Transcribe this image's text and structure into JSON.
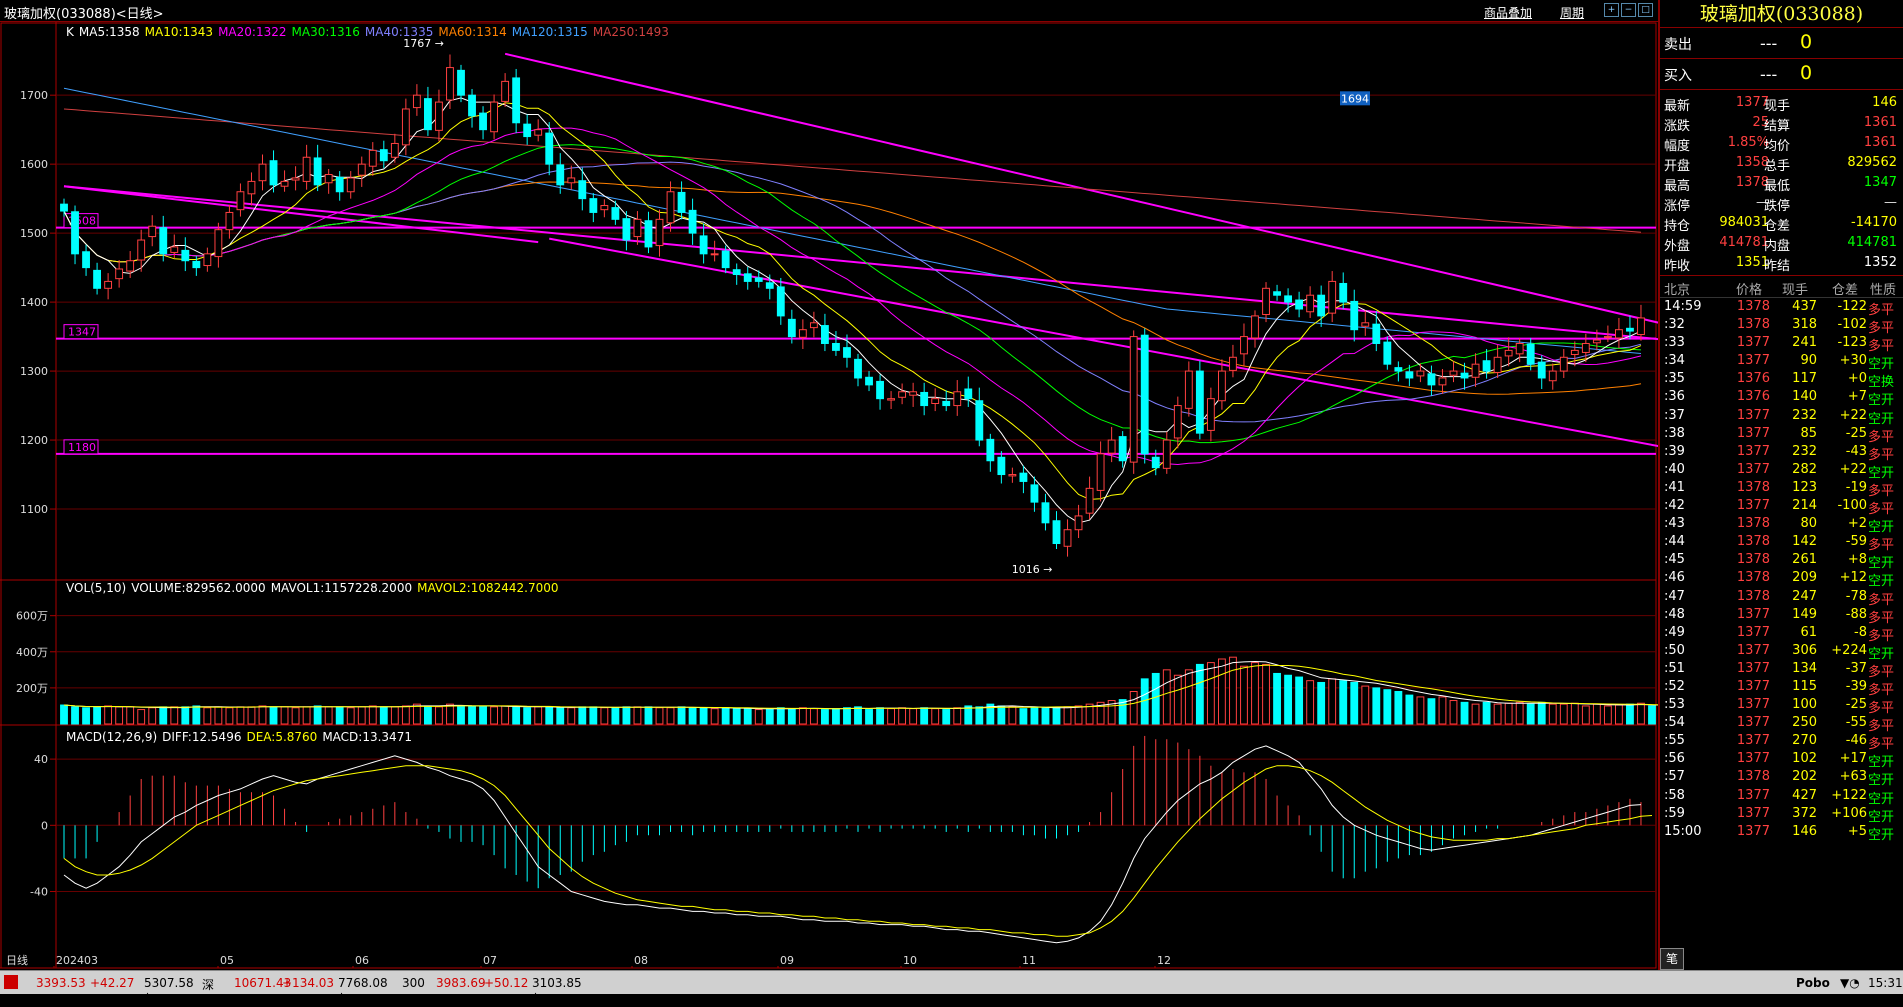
{
  "window": {
    "title": "玻璃加权(033088)<日线>",
    "link_overlay": "商品叠加",
    "link_period": "周期"
  },
  "indicators": {
    "main": [
      {
        "t": "K",
        "c": "#ffffff"
      },
      {
        "t": "MA5:1358",
        "c": "#ffffff"
      },
      {
        "t": "MA10:1343",
        "c": "#ffff00"
      },
      {
        "t": "MA20:1322",
        "c": "#ff00ff"
      },
      {
        "t": "MA30:1316",
        "c": "#00ff00"
      },
      {
        "t": "MA40:1335",
        "c": "#8080ff"
      },
      {
        "t": "MA60:1314",
        "c": "#ff8000"
      },
      {
        "t": "MA120:1315",
        "c": "#40a0ff"
      },
      {
        "t": "MA250:1493",
        "c": "#d04040"
      }
    ],
    "vol": [
      {
        "t": "VOL(5,10)",
        "c": "#ffffff"
      },
      {
        "t": "VOLUME:829562.0000",
        "c": "#ffffff"
      },
      {
        "t": "MAVOL1:1157228.2000",
        "c": "#ffffff"
      },
      {
        "t": "MAVOL2:1082442.7000",
        "c": "#ffff00"
      }
    ],
    "macd": [
      {
        "t": "MACD(12,26,9)",
        "c": "#ffffff"
      },
      {
        "t": "DIFF:12.5496",
        "c": "#ffffff"
      },
      {
        "t": "DEA:5.8760",
        "c": "#ffff00"
      },
      {
        "t": "MACD:13.3471",
        "c": "#ffffff"
      }
    ]
  },
  "axes": {
    "price_ticks": [
      "1700",
      "1600",
      "1500",
      "1400",
      "1300",
      "1200",
      "1100"
    ],
    "vol_ticks": [
      "600万",
      "400万",
      "200万"
    ],
    "macd_ticks": [
      "40",
      "0",
      "-40"
    ],
    "x_labels": [
      "日线",
      "202403",
      "05",
      "06",
      "07",
      "08",
      "09",
      "10",
      "11",
      "12"
    ]
  },
  "annotations": {
    "high": "1767",
    "low": "1016",
    "level1": "1508",
    "level2": "1347",
    "level3": "1180",
    "cursor_price": "1694"
  },
  "chart_data": {
    "type": "candlestick",
    "ylim": [
      1000,
      1780
    ],
    "macd_ylim": [
      -85,
      60
    ],
    "levels": [
      1508,
      1347,
      1180
    ],
    "high_label": 1767,
    "low_label": 1016,
    "closes": [
      1532,
      1470,
      1450,
      1420,
      1430,
      1448,
      1460,
      1490,
      1510,
      1470,
      1480,
      1460,
      1450,
      1470,
      1505,
      1530,
      1560,
      1575,
      1600,
      1570,
      1575,
      1580,
      1610,
      1570,
      1585,
      1560,
      1580,
      1600,
      1620,
      1605,
      1630,
      1680,
      1700,
      1650,
      1690,
      1740,
      1700,
      1670,
      1650,
      1690,
      1720,
      1660,
      1640,
      1650,
      1600,
      1570,
      1580,
      1550,
      1530,
      1540,
      1520,
      1490,
      1520,
      1480,
      1520,
      1560,
      1530,
      1500,
      1470,
      1470,
      1450,
      1440,
      1430,
      1430,
      1420,
      1380,
      1350,
      1360,
      1370,
      1340,
      1330,
      1320,
      1290,
      1280,
      1260,
      1260,
      1270,
      1270,
      1250,
      1260,
      1250,
      1270,
      1260,
      1200,
      1170,
      1150,
      1150,
      1140,
      1110,
      1080,
      1050,
      1070,
      1090,
      1130,
      1180,
      1200,
      1170,
      1350,
      1180,
      1160,
      1200,
      1250,
      1300,
      1210,
      1260,
      1300,
      1320,
      1350,
      1380,
      1420,
      1410,
      1400,
      1390,
      1410,
      1380,
      1430,
      1400,
      1360,
      1370,
      1340,
      1310,
      1300,
      1290,
      1300,
      1280,
      1290,
      1300,
      1290,
      1310,
      1300,
      1320,
      1330,
      1340,
      1310,
      1290,
      1300,
      1320,
      1330,
      1340,
      1345,
      1350,
      1360,
      1358,
      1377
    ],
    "volumes": [
      105,
      95,
      90,
      95,
      100,
      95,
      95,
      80,
      90,
      95,
      95,
      95,
      100,
      90,
      95,
      90,
      95,
      95,
      100,
      95,
      95,
      90,
      95,
      100,
      95,
      95,
      90,
      95,
      100,
      95,
      95,
      100,
      110,
      100,
      95,
      110,
      100,
      100,
      95,
      95,
      100,
      95,
      90,
      95,
      95,
      90,
      90,
      95,
      95,
      90,
      90,
      95,
      95,
      95,
      90,
      90,
      95,
      90,
      90,
      85,
      90,
      85,
      85,
      80,
      85,
      90,
      85,
      90,
      85,
      80,
      85,
      90,
      95,
      80,
      90,
      85,
      90,
      85,
      90,
      85,
      80,
      90,
      100,
      95,
      110,
      100,
      95,
      85,
      90,
      90,
      90,
      95,
      100,
      110,
      120,
      130,
      135,
      180,
      250,
      280,
      300,
      270,
      300,
      330,
      340,
      360,
      370,
      320,
      340,
      330,
      280,
      270,
      260,
      240,
      230,
      250,
      240,
      230,
      210,
      200,
      190,
      180,
      160,
      150,
      140,
      150,
      130,
      120,
      110,
      120,
      110,
      115,
      120,
      110,
      120,
      110,
      110,
      115,
      100,
      110,
      100,
      105,
      110,
      115,
      100,
      95
    ],
    "dif": [
      -30,
      -35,
      -38,
      -35,
      -30,
      -25,
      -18,
      -10,
      -5,
      0,
      5,
      8,
      12,
      15,
      18,
      20,
      22,
      25,
      28,
      30,
      28,
      26,
      25,
      28,
      30,
      32,
      34,
      36,
      38,
      40,
      42,
      40,
      38,
      35,
      33,
      30,
      28,
      26,
      22,
      15,
      5,
      -5,
      -15,
      -25,
      -30,
      -35,
      -40,
      -42,
      -44,
      -46,
      -47,
      -48,
      -48,
      -49,
      -50,
      -50,
      -51,
      -52,
      -52,
      -53,
      -53,
      -54,
      -54,
      -55,
      -55,
      -55,
      -56,
      -57,
      -57,
      -58,
      -58,
      -58,
      -59,
      -59,
      -60,
      -60,
      -60,
      -61,
      -61,
      -62,
      -63,
      -63,
      -64,
      -64,
      -65,
      -66,
      -67,
      -68,
      -69,
      -70,
      -71,
      -70,
      -68,
      -64,
      -58,
      -48,
      -35,
      -20,
      -8,
      0,
      8,
      15,
      20,
      25,
      28,
      32,
      38,
      42,
      46,
      48,
      45,
      42,
      38,
      30,
      22,
      12,
      5,
      0,
      -3,
      -6,
      -8,
      -10,
      -12,
      -14,
      -15,
      -14,
      -13,
      -12,
      -11,
      -10,
      -9,
      -8,
      -7,
      -6,
      -4,
      -2,
      0,
      2,
      4,
      6,
      8,
      10,
      12,
      12.5
    ],
    "dea": [
      -20,
      -25,
      -28,
      -30,
      -30,
      -29,
      -27,
      -24,
      -20,
      -15,
      -10,
      -5,
      0,
      3,
      6,
      9,
      12,
      15,
      18,
      21,
      23,
      25,
      27,
      28,
      29,
      30,
      31,
      32,
      33,
      34,
      35,
      36,
      36,
      36,
      35,
      34,
      33,
      31,
      28,
      24,
      18,
      10,
      2,
      -6,
      -14,
      -20,
      -26,
      -31,
      -35,
      -38,
      -41,
      -43,
      -45,
      -46,
      -47,
      -48,
      -49,
      -49,
      -50,
      -51,
      -51,
      -52,
      -52,
      -53,
      -53,
      -54,
      -54,
      -55,
      -55,
      -56,
      -56,
      -57,
      -57,
      -58,
      -58,
      -59,
      -59,
      -60,
      -60,
      -61,
      -61,
      -62,
      -62,
      -63,
      -63,
      -64,
      -65,
      -65,
      -66,
      -66,
      -67,
      -67,
      -66,
      -65,
      -62,
      -58,
      -52,
      -44,
      -35,
      -26,
      -18,
      -10,
      -3,
      4,
      10,
      16,
      21,
      26,
      30,
      34,
      36,
      36,
      35,
      33,
      30,
      26,
      21,
      16,
      11,
      7,
      3,
      0,
      -3,
      -5,
      -7,
      -8,
      -9,
      -9,
      -9,
      -9,
      -8,
      -8,
      -7,
      -6,
      -5,
      -4,
      -3,
      -2,
      0,
      1,
      2,
      3,
      4,
      5.5,
      5.9
    ]
  },
  "quote": {
    "title": "玻璃加权(033088)",
    "sell_label": "卖出",
    "sell_price": "---",
    "sell_vol": "0",
    "buy_label": "买入",
    "buy_price": "---",
    "buy_vol": "0",
    "rows": [
      {
        "l1": "最新",
        "v1": "1377",
        "c1": "#ff4040",
        "l2": "现手",
        "v2": "146",
        "c2": "#ffff00"
      },
      {
        "l1": "涨跌",
        "v1": "25",
        "c1": "#ff4040",
        "l2": "结算",
        "v2": "1361",
        "c2": "#ff4040"
      },
      {
        "l1": "幅度",
        "v1": "1.85%",
        "c1": "#ff4040",
        "l2": "均价",
        "v2": "1361",
        "c2": "#ff4040"
      },
      {
        "l1": "开盘",
        "v1": "1358",
        "c1": "#ff4040",
        "l2": "总手",
        "v2": "829562",
        "c2": "#ffff00"
      },
      {
        "l1": "最高",
        "v1": "1378",
        "c1": "#ff4040",
        "l2": "最低",
        "v2": "1347",
        "c2": "#00ff00"
      },
      {
        "l1": "涨停",
        "v1": "—",
        "c1": "#dddddd",
        "l2": "跌停",
        "v2": "—",
        "c2": "#dddddd"
      },
      {
        "l1": "持仓",
        "v1": "984031",
        "c1": "#ffff00",
        "l2": "仓差",
        "v2": "-14170",
        "c2": "#ffff00"
      },
      {
        "l1": "外盘",
        "v1": "414781",
        "c1": "#ff4040",
        "l2": "内盘",
        "v2": "414781",
        "c2": "#00ff00"
      },
      {
        "l1": "昨收",
        "v1": "1351",
        "c1": "#ffff00",
        "l2": "昨结",
        "v2": "1352",
        "c2": "#ffffff"
      }
    ],
    "tick_headers": [
      "北京",
      "价格",
      "现手",
      "仓差",
      "性质"
    ],
    "ticks": [
      {
        "t": "14:59",
        "p": "1378",
        "v": "437",
        "d": "-122",
        "n": "多平"
      },
      {
        "t": ":32",
        "p": "1378",
        "v": "318",
        "d": "-102",
        "n": "多平"
      },
      {
        "t": ":33",
        "p": "1377",
        "v": "241",
        "d": "-123",
        "n": "多平"
      },
      {
        "t": ":34",
        "p": "1377",
        "v": "90",
        "d": "+30",
        "n": "空开"
      },
      {
        "t": ":35",
        "p": "1376",
        "v": "117",
        "d": "+0",
        "n": "空换"
      },
      {
        "t": ":36",
        "p": "1376",
        "v": "140",
        "d": "+7",
        "n": "空开"
      },
      {
        "t": ":37",
        "p": "1377",
        "v": "232",
        "d": "+22",
        "n": "空开"
      },
      {
        "t": ":38",
        "p": "1377",
        "v": "85",
        "d": "-25",
        "n": "多平"
      },
      {
        "t": ":39",
        "p": "1377",
        "v": "232",
        "d": "-43",
        "n": "多平"
      },
      {
        "t": ":40",
        "p": "1377",
        "v": "282",
        "d": "+22",
        "n": "空开"
      },
      {
        "t": ":41",
        "p": "1378",
        "v": "123",
        "d": "-19",
        "n": "多平"
      },
      {
        "t": ":42",
        "p": "1377",
        "v": "214",
        "d": "-100",
        "n": "多平"
      },
      {
        "t": ":43",
        "p": "1378",
        "v": "80",
        "d": "+2",
        "n": "空开"
      },
      {
        "t": ":44",
        "p": "1378",
        "v": "142",
        "d": "-59",
        "n": "多平"
      },
      {
        "t": ":45",
        "p": "1378",
        "v": "261",
        "d": "+8",
        "n": "空开"
      },
      {
        "t": ":46",
        "p": "1378",
        "v": "209",
        "d": "+12",
        "n": "空开"
      },
      {
        "t": ":47",
        "p": "1378",
        "v": "247",
        "d": "-78",
        "n": "多平"
      },
      {
        "t": ":48",
        "p": "1377",
        "v": "149",
        "d": "-88",
        "n": "多平"
      },
      {
        "t": ":49",
        "p": "1377",
        "v": "61",
        "d": "-8",
        "n": "多平"
      },
      {
        "t": ":50",
        "p": "1377",
        "v": "306",
        "d": "+224",
        "n": "空开"
      },
      {
        "t": ":51",
        "p": "1377",
        "v": "134",
        "d": "-37",
        "n": "多平"
      },
      {
        "t": ":52",
        "p": "1377",
        "v": "115",
        "d": "-39",
        "n": "多平"
      },
      {
        "t": ":53",
        "p": "1377",
        "v": "100",
        "d": "-25",
        "n": "多平"
      },
      {
        "t": ":54",
        "p": "1377",
        "v": "250",
        "d": "-55",
        "n": "多平"
      },
      {
        "t": ":55",
        "p": "1377",
        "v": "270",
        "d": "-46",
        "n": "多平"
      },
      {
        "t": ":56",
        "p": "1377",
        "v": "102",
        "d": "+17",
        "n": "空开"
      },
      {
        "t": ":57",
        "p": "1378",
        "v": "202",
        "d": "+63",
        "n": "空开"
      },
      {
        "t": ":58",
        "p": "1377",
        "v": "427",
        "d": "+122",
        "n": "空开"
      },
      {
        "t": ":59",
        "p": "1377",
        "v": "372",
        "d": "+106",
        "n": "空开"
      },
      {
        "t": "15:00",
        "p": "1377",
        "v": "146",
        "d": "+5",
        "n": "空开"
      }
    ],
    "tab": "笔"
  },
  "statusbar": {
    "items": [
      {
        "t": "3393.53",
        "c": "#d00000"
      },
      {
        "t": "+42.27",
        "c": "#d00000"
      },
      {
        "t": "5307.58亿",
        "c": "#000000"
      },
      {
        "t": "深",
        "c": "#000000"
      },
      {
        "t": "10671.43",
        "c": "#d00000"
      },
      {
        "t": "+134.03",
        "c": "#d00000"
      },
      {
        "t": "7768.08亿",
        "c": "#000000"
      },
      {
        "t": "300",
        "c": "#000000"
      },
      {
        "t": "3983.69",
        "c": "#d00000"
      },
      {
        "t": "+50.12",
        "c": "#d00000"
      },
      {
        "t": "3103.85亿",
        "c": "#000000"
      }
    ],
    "brand": "Pobo",
    "time": "15:31"
  }
}
